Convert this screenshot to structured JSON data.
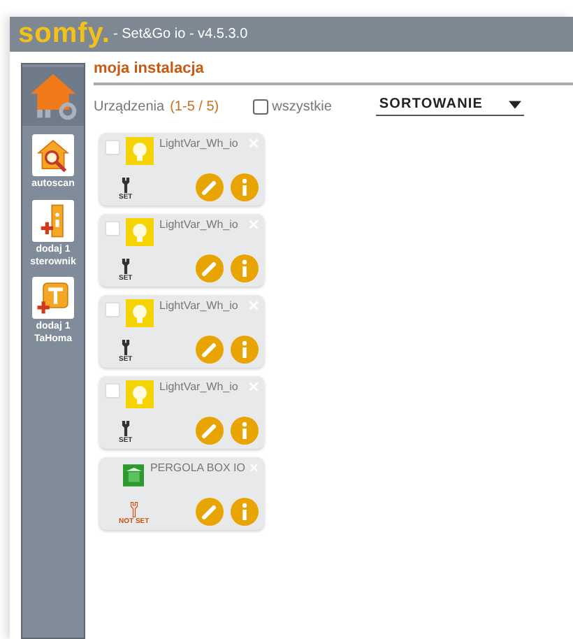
{
  "window": {
    "logo": "somfy.",
    "title": "- Set&Go io - v4.5.3.0"
  },
  "sidebar": {
    "items": [
      {
        "kind": "home",
        "selected": true
      },
      {
        "kind": "autoscan",
        "label": "autoscan",
        "selected": false
      },
      {
        "kind": "add-controller",
        "label": "dodaj 1 sterownik",
        "selected": false
      },
      {
        "kind": "add-box",
        "label": "dodaj 1 TaHoma",
        "selected": false
      }
    ]
  },
  "page_title": "moja instalacja",
  "filter": {
    "label": "Urządzenia",
    "count": "(1-5 / 5)",
    "select_all": {
      "label": "wszystkie",
      "checked": false
    },
    "sort": "SORTOWANIE"
  },
  "devices": [
    {
      "name": "LightVar_Wh_io",
      "kind": "light",
      "status": "SET",
      "configured": true,
      "checked": false
    },
    {
      "name": "LightVar_Wh_io",
      "kind": "light",
      "status": "SET",
      "configured": true,
      "checked": false
    },
    {
      "name": "LightVar_Wh_io",
      "kind": "light",
      "status": "SET",
      "configured": true,
      "checked": false
    },
    {
      "name": "LightVar_Wh_io",
      "kind": "light",
      "status": "SET",
      "configured": true,
      "checked": false
    },
    {
      "name": "PERGOLA BOX IO",
      "kind": "pergola",
      "status": "NOT SET",
      "configured": false
    }
  ]
}
